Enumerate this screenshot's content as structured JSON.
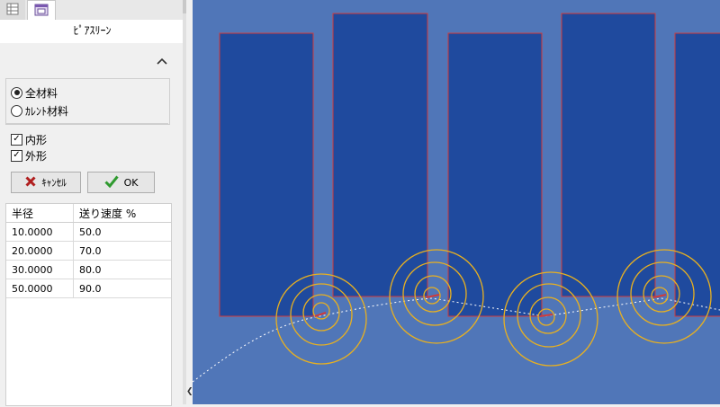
{
  "panel": {
    "tabs": [
      {
        "icon": "grid-icon"
      },
      {
        "icon": "window-icon"
      }
    ],
    "title": "ﾋﾟｱｽﾘｰﾝ",
    "collapse_icon": "chevron-up-icon"
  },
  "material_options": {
    "all": "全材料",
    "current": "ｶﾚﾝﾄ材料",
    "selected": "all"
  },
  "shape_options": {
    "inner": {
      "label": "内形",
      "checked": true
    },
    "outer": {
      "label": "外形",
      "checked": true
    }
  },
  "buttons": {
    "cancel": "ｷｬﾝｾﾙ",
    "ok": "OK"
  },
  "table": {
    "headers": [
      "半径",
      "送り速度 %"
    ],
    "rows": [
      [
        "10.0000",
        "50.0"
      ],
      [
        "20.0000",
        "70.0"
      ],
      [
        "30.0000",
        "80.0"
      ],
      [
        "50.0000",
        "90.0"
      ]
    ]
  },
  "canvas": {
    "background": "#5076b8",
    "part_fill": "#1f4a9e",
    "part_edge": "#d03a3a",
    "spiral_color": "#e8b020",
    "path_color": "#ffffff"
  }
}
